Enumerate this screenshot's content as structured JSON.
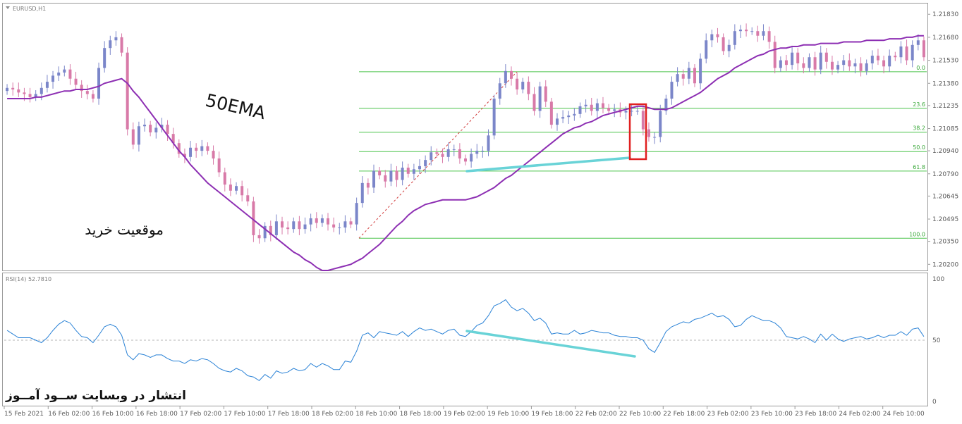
{
  "window": {
    "main_title": "EURUSD,H1",
    "rsi_title": "RSI(14) 52.7810"
  },
  "annotations": {
    "ema_label": "50EMA",
    "position_label": "موقعیت خرید",
    "watermark": "انتشار در وبسایت ســود آمــوز"
  },
  "colors": {
    "bull_candle": "#7b86c9",
    "bear_candle": "#d87aa8",
    "ema": "#8d2fb3",
    "fib": "#4cc44c",
    "rsi": "#2a82d6",
    "trendline": "#69d3d7",
    "highlight_box": "#e02020"
  },
  "chart_data": [
    {
      "type": "candlestick",
      "title": "EURUSD,H1",
      "ylim": [
        1.2016,
        1.219
      ],
      "y_ticks": [
        "1.21830",
        "1.21680",
        "1.21530",
        "1.21380",
        "1.21235",
        "1.21085",
        "1.20940",
        "1.20790",
        "1.20645",
        "1.20495",
        "1.20350",
        "1.20200"
      ],
      "x_ticks": [
        "15 Feb 2021",
        "16 Feb 02:00",
        "16 Feb 10:00",
        "16 Feb 18:00",
        "17 Feb 02:00",
        "17 Feb 10:00",
        "17 Feb 18:00",
        "18 Feb 02:00",
        "18 Feb 10:00",
        "18 Feb 18:00",
        "19 Feb 02:00",
        "19 Feb 10:00",
        "19 Feb 18:00",
        "22 Feb 02:00",
        "22 Feb 10:00",
        "22 Feb 18:00",
        "23 Feb 02:00",
        "23 Feb 10:00",
        "23 Feb 18:00",
        "24 Feb 02:00",
        "24 Feb 10:00"
      ],
      "close": [
        1.2135,
        1.2134,
        1.2132,
        1.2131,
        1.2129,
        1.2131,
        1.2135,
        1.2139,
        1.2143,
        1.2145,
        1.2147,
        1.2141,
        1.2137,
        1.2133,
        1.2131,
        1.2128,
        1.2148,
        1.2161,
        1.2166,
        1.2168,
        1.2158,
        1.2108,
        1.2098,
        1.211,
        1.2111,
        1.2106,
        1.2109,
        1.2111,
        1.2105,
        1.2099,
        1.2092,
        1.209,
        1.2096,
        1.2094,
        1.2097,
        1.2094,
        1.2089,
        1.208,
        1.2072,
        1.2068,
        1.2071,
        1.2065,
        1.2061,
        1.2039,
        1.2037,
        1.2045,
        1.2039,
        1.2048,
        1.2044,
        1.2043,
        1.2048,
        1.2043,
        1.2046,
        1.205,
        1.2047,
        1.205,
        1.2046,
        1.2044,
        1.2044,
        1.2048,
        1.2046,
        1.206,
        1.2073,
        1.207,
        1.2081,
        1.2078,
        1.2074,
        1.2081,
        1.2075,
        1.2083,
        1.2079,
        1.2082,
        1.2084,
        1.2088,
        1.2093,
        1.2092,
        1.209,
        1.2095,
        1.2095,
        1.2089,
        1.2087,
        1.2092,
        1.2094,
        1.2094,
        1.2104,
        1.2128,
        1.2138,
        1.2146,
        1.2141,
        1.2134,
        1.2139,
        1.2131,
        1.212,
        1.2136,
        1.2126,
        1.2111,
        1.2115,
        1.2116,
        1.2117,
        1.2118,
        1.2123,
        1.2124,
        1.212,
        1.2125,
        1.2122,
        1.212,
        1.2121,
        1.2119,
        1.212,
        1.212,
        1.212,
        1.2108,
        1.2103,
        1.2103,
        1.212,
        1.2128,
        1.2139,
        1.2144,
        1.2141,
        1.2148,
        1.2138,
        1.2154,
        1.2166,
        1.217,
        1.2168,
        1.2159,
        1.2163,
        1.2172,
        1.2173,
        1.2172,
        1.2172,
        1.2169,
        1.2172,
        1.2165,
        1.2148,
        1.2153,
        1.215,
        1.2158,
        1.2151,
        1.2148,
        1.2155,
        1.2147,
        1.2158,
        1.2152,
        1.2147,
        1.215,
        1.2153,
        1.2149,
        1.2151,
        1.2146,
        1.2151,
        1.2156,
        1.2153,
        1.2149,
        1.2156,
        1.2155,
        1.2162,
        1.2153,
        1.2163,
        1.2166,
        1.2155
      ],
      "ema50": [
        1.2128,
        1.2128,
        1.2128,
        1.2128,
        1.2128,
        1.2129,
        1.2129,
        1.213,
        1.2131,
        1.2132,
        1.2133,
        1.2133,
        1.2134,
        1.2134,
        1.2134,
        1.2135,
        1.2136,
        1.2138,
        1.2139,
        1.214,
        1.2141,
        1.2138,
        1.2133,
        1.2129,
        1.2124,
        1.2119,
        1.2114,
        1.2109,
        1.2104,
        1.2099,
        1.2094,
        1.209,
        1.2085,
        1.2081,
        1.2077,
        1.2073,
        1.207,
        1.2067,
        1.2064,
        1.2061,
        1.2058,
        1.2055,
        1.2052,
        1.2049,
        1.2046,
        1.2043,
        1.204,
        1.2037,
        1.2034,
        1.2031,
        1.2028,
        1.2026,
        1.2023,
        1.2021,
        1.2018,
        1.2016,
        1.2016,
        1.2017,
        1.2018,
        1.2019,
        1.202,
        1.2022,
        1.2024,
        1.2027,
        1.203,
        1.2033,
        1.2037,
        1.2041,
        1.2045,
        1.2048,
        1.2052,
        1.2055,
        1.2057,
        1.2059,
        1.206,
        1.2061,
        1.2062,
        1.2062,
        1.2062,
        1.2062,
        1.2062,
        1.2063,
        1.2064,
        1.2066,
        1.2068,
        1.207,
        1.2073,
        1.2076,
        1.2078,
        1.2081,
        1.2084,
        1.2087,
        1.209,
        1.2093,
        1.2096,
        1.2099,
        1.2102,
        1.2105,
        1.2107,
        1.2109,
        1.211,
        1.2112,
        1.2113,
        1.2115,
        1.2117,
        1.2118,
        1.2119,
        1.212,
        1.2121,
        1.2122,
        1.2123,
        1.2123,
        1.2122,
        1.2121,
        1.2121,
        1.2121,
        1.2122,
        1.2124,
        1.2126,
        1.2128,
        1.213,
        1.2132,
        1.2135,
        1.2138,
        1.2141,
        1.2143,
        1.2145,
        1.2148,
        1.215,
        1.2152,
        1.2154,
        1.2156,
        1.2157,
        1.2159,
        1.216,
        1.2161,
        1.2161,
        1.2162,
        1.2162,
        1.2163,
        1.2163,
        1.2163,
        1.2164,
        1.2164,
        1.2164,
        1.2164,
        1.2165,
        1.2165,
        1.2165,
        1.2165,
        1.2166,
        1.2166,
        1.2166,
        1.2166,
        1.2167,
        1.2167,
        1.2167,
        1.2168,
        1.2168,
        1.2169,
        1.2169
      ],
      "fibonacci": {
        "levels": [
          "0.0",
          "23.6",
          "38.2",
          "50.0",
          "61.8",
          "100.0"
        ],
        "prices": [
          1.21455,
          1.21217,
          1.21061,
          1.20935,
          1.20808,
          1.2037
        ]
      }
    },
    {
      "type": "line",
      "title": "RSI(14) 52.7810",
      "ylim": [
        0,
        100
      ],
      "y_ticks": [
        "100",
        "50",
        "0"
      ],
      "reference_line": 50,
      "values": [
        58,
        55,
        52,
        52,
        52,
        50,
        48,
        52,
        58,
        63,
        66,
        64,
        58,
        53,
        52,
        48,
        54,
        61,
        63,
        61,
        54,
        38,
        34,
        39,
        38,
        36,
        38,
        38,
        35,
        33,
        33,
        31,
        34,
        33,
        35,
        34,
        31,
        27,
        25,
        24,
        27,
        25,
        21,
        20,
        17,
        22,
        19,
        25,
        23,
        24,
        27,
        25,
        26,
        31,
        28,
        31,
        29,
        26,
        26,
        33,
        32,
        41,
        54,
        56,
        52,
        57,
        56,
        55,
        54,
        57,
        53,
        57,
        60,
        58,
        59,
        57,
        55,
        58,
        59,
        54,
        53,
        57,
        62,
        64,
        70,
        78,
        80,
        83,
        77,
        74,
        76,
        72,
        66,
        68,
        64,
        55,
        56,
        55,
        55,
        58,
        55,
        56,
        58,
        57,
        56,
        56,
        54,
        53,
        53,
        52,
        52,
        50,
        43,
        40,
        48,
        57,
        61,
        63,
        65,
        64,
        67,
        68,
        70,
        72,
        69,
        70,
        67,
        61,
        62,
        67,
        70,
        68,
        66,
        66,
        64,
        60,
        53,
        52,
        51,
        53,
        51,
        48,
        55,
        50,
        55,
        51,
        49,
        51,
        52,
        53,
        51,
        52,
        54,
        52,
        54,
        54,
        57,
        54,
        59,
        60,
        53
      ]
    }
  ]
}
